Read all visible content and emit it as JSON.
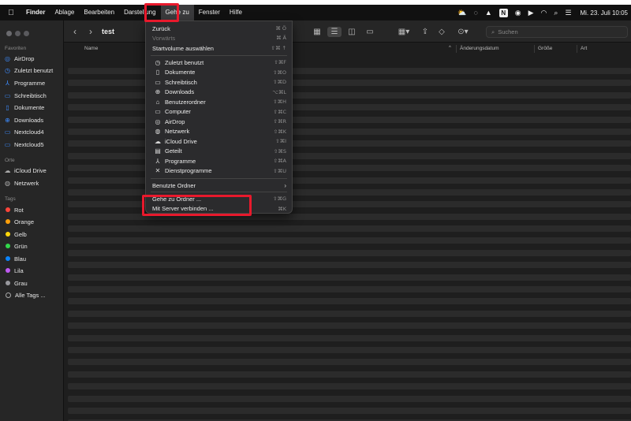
{
  "menubar": {
    "app": "Finder",
    "items": [
      "Ablage",
      "Bearbeiten",
      "Darstellung",
      "Gehe zu",
      "Fenster",
      "Hilfe"
    ],
    "clock": "Mi. 23. Juli  10:05",
    "status_icons": [
      "weather-icon",
      "chat-icon",
      "drive-icon",
      "notion-icon",
      "user-icon",
      "play-icon",
      "wifi-icon",
      "search-icon",
      "control-center-icon"
    ]
  },
  "sidebar": {
    "favorites_title": "Favoriten",
    "favorites": [
      {
        "label": "AirDrop",
        "icon": "airdrop-icon"
      },
      {
        "label": "Zuletzt benutzt",
        "icon": "clock-icon"
      },
      {
        "label": "Programme",
        "icon": "apps-icon"
      },
      {
        "label": "Schreibtisch",
        "icon": "desktop-icon"
      },
      {
        "label": "Dokumente",
        "icon": "document-icon"
      },
      {
        "label": "Downloads",
        "icon": "download-icon"
      },
      {
        "label": "Nextcloud4",
        "icon": "folder-icon"
      },
      {
        "label": "Nextcloud5",
        "icon": "folder-icon"
      }
    ],
    "locations_title": "Orte",
    "locations": [
      {
        "label": "iCloud Drive",
        "icon": "cloud-icon"
      },
      {
        "label": "Netzwerk",
        "icon": "globe-icon"
      }
    ],
    "tags_title": "Tags",
    "tags": [
      {
        "label": "Rot",
        "color": "#ff453a"
      },
      {
        "label": "Orange",
        "color": "#ff9f0a"
      },
      {
        "label": "Gelb",
        "color": "#ffd60a"
      },
      {
        "label": "Grün",
        "color": "#32d74b"
      },
      {
        "label": "Blau",
        "color": "#0a84ff"
      },
      {
        "label": "Lila",
        "color": "#bf5af2"
      },
      {
        "label": "Grau",
        "color": "#98989d"
      },
      {
        "label": "Alle Tags ...",
        "color": ""
      }
    ]
  },
  "toolbar": {
    "title": "test",
    "search_placeholder": "Suchen"
  },
  "columns": {
    "name": "Name",
    "date": "Änderungsdatum",
    "size": "Größe",
    "kind": "Art"
  },
  "goto_menu": {
    "items": [
      {
        "label": "Zurück",
        "shortcut": "⌘ Ö",
        "disabled": false
      },
      {
        "label": "Vorwärts",
        "shortcut": "⌘ Ä",
        "disabled": true
      },
      {
        "label": "Startvolume auswählen",
        "shortcut": "⇧⌘ ↑",
        "disabled": false
      },
      {
        "label": "Zuletzt benutzt",
        "shortcut": "⇧⌘F",
        "icon": "clock-icon"
      },
      {
        "label": "Dokumente",
        "shortcut": "⇧⌘O",
        "icon": "document-icon"
      },
      {
        "label": "Schreibtisch",
        "shortcut": "⇧⌘D",
        "icon": "desktop-icon"
      },
      {
        "label": "Downloads",
        "shortcut": "⌥⌘L",
        "icon": "download-icon"
      },
      {
        "label": "Benutzerordner",
        "shortcut": "⇧⌘H",
        "icon": "home-icon"
      },
      {
        "label": "Computer",
        "shortcut": "⇧⌘C",
        "icon": "computer-icon"
      },
      {
        "label": "AirDrop",
        "shortcut": "⇧⌘R",
        "icon": "airdrop-icon"
      },
      {
        "label": "Netzwerk",
        "shortcut": "⇧⌘K",
        "icon": "globe-icon"
      },
      {
        "label": "iCloud Drive",
        "shortcut": "⇧⌘I",
        "icon": "cloud-icon"
      },
      {
        "label": "Geteilt",
        "shortcut": "⇧⌘S",
        "icon": "shared-folder-icon"
      },
      {
        "label": "Programme",
        "shortcut": "⇧⌘A",
        "icon": "apps-icon"
      },
      {
        "label": "Dienstprogramme",
        "shortcut": "⇧⌘U",
        "icon": "tools-icon"
      },
      {
        "label": "Benutzte Ordner",
        "shortcut": "›"
      },
      {
        "label": "Gehe zu Ordner ...",
        "shortcut": "⇧⌘G"
      },
      {
        "label": "Mit Server verbinden ...",
        "shortcut": "⌘K"
      }
    ]
  },
  "highlight_color": "#e8192c"
}
